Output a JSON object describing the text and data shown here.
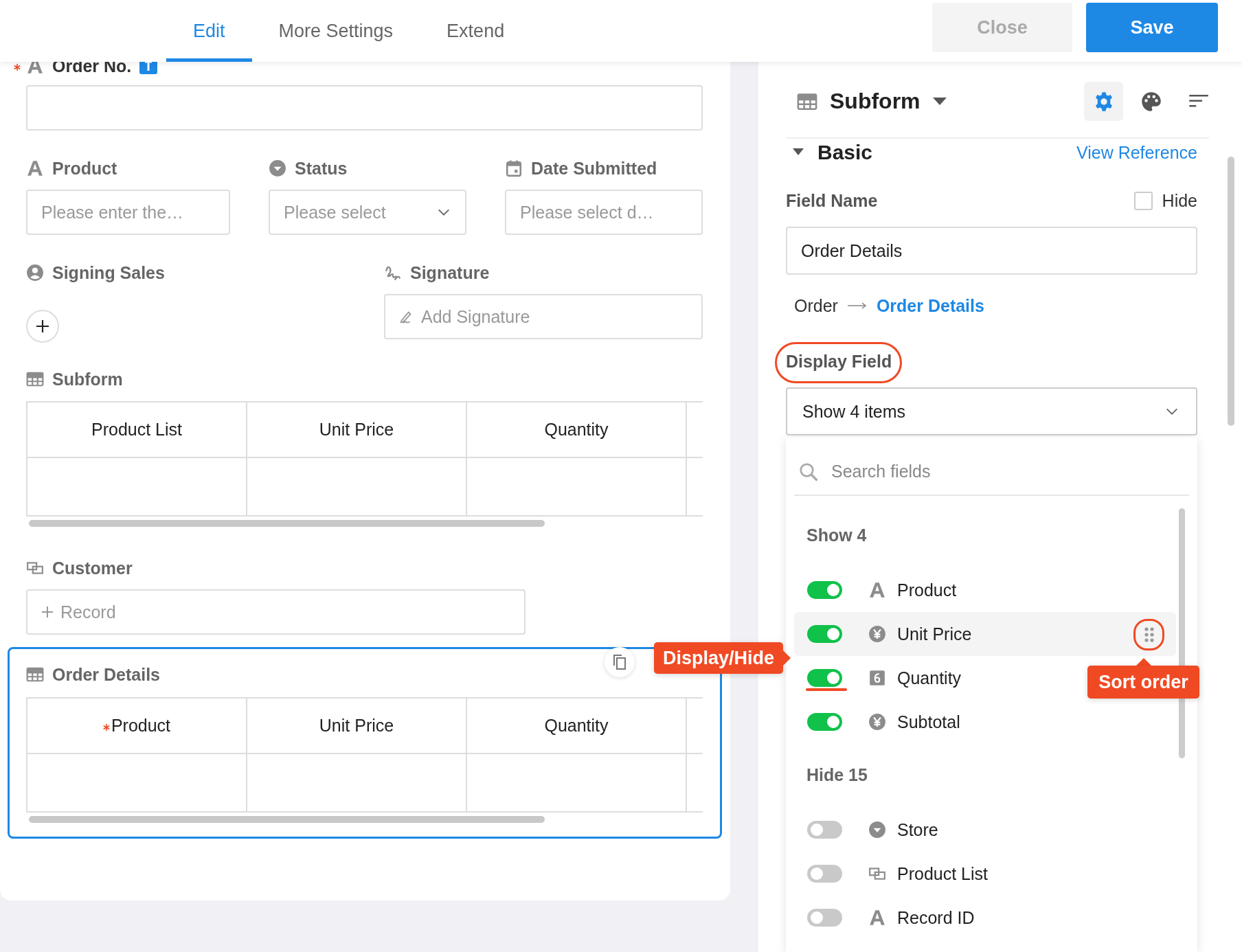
{
  "tabs": [
    {
      "label": "Edit",
      "selected": true
    },
    {
      "label": "More Settings",
      "selected": false
    },
    {
      "label": "Extend",
      "selected": false
    }
  ],
  "actions": [
    {
      "label": "Close",
      "kind": "secondary"
    },
    {
      "label": "Save",
      "kind": "primary"
    }
  ],
  "form": {
    "order_no": {
      "label": "Order No.",
      "required": true
    },
    "row_fields": [
      {
        "label": "Product",
        "kind": "text",
        "placeholder": "Please enter the…"
      },
      {
        "label": "Status",
        "kind": "select",
        "placeholder": "Please select"
      },
      {
        "label": "Date Submitted",
        "kind": "date",
        "placeholder": "Please select d…"
      }
    ],
    "signing_sales": {
      "label": "Signing Sales"
    },
    "signature": {
      "label": "Signature",
      "placeholder": "Add Signature"
    },
    "subform": {
      "label": "Subform",
      "columns": [
        {
          "label": "Product List",
          "required": false
        },
        {
          "label": "Unit Price",
          "required": false
        },
        {
          "label": "Quantity",
          "required": false
        }
      ]
    },
    "customer": {
      "label": "Customer",
      "placeholder": "Record"
    },
    "order_details": {
      "label": "Order Details",
      "selected": true,
      "columns": [
        {
          "label": "Product",
          "required": true
        },
        {
          "label": "Unit Price",
          "required": false
        },
        {
          "label": "Quantity",
          "required": false
        }
      ]
    }
  },
  "panel": {
    "title": "Subform",
    "tools": [
      {
        "kind": "settings",
        "selected": true
      },
      {
        "kind": "palette",
        "selected": false
      },
      {
        "kind": "sort",
        "selected": false
      }
    ],
    "section": {
      "title": "Basic",
      "expanded": true,
      "link": "View Reference"
    },
    "field_name": {
      "label": "Field Name",
      "value": "Order Details"
    },
    "hide": {
      "label": "Hide",
      "checked": false
    },
    "path": {
      "from": "Order",
      "to": "Order Details"
    },
    "display_field": {
      "label": "Display Field",
      "value": "Show 4 items",
      "circled": true
    },
    "dropdown": {
      "placeholder": "Search fields",
      "groups": [
        {
          "title": "Show 4",
          "items": [
            {
              "label": "Product",
              "kind": "text",
              "on": true,
              "hovered": false,
              "underlined": false
            },
            {
              "label": "Unit Price",
              "kind": "money",
              "on": true,
              "hovered": true,
              "underlined": false
            },
            {
              "label": "Quantity",
              "kind": "number",
              "on": true,
              "hovered": false,
              "underlined": true
            },
            {
              "label": "Subtotal",
              "kind": "money",
              "on": true,
              "hovered": false,
              "underlined": false
            }
          ]
        },
        {
          "title": "Hide 15",
          "items": [
            {
              "label": "Store",
              "kind": "select",
              "on": false,
              "hovered": false,
              "underlined": false
            },
            {
              "label": "Product List",
              "kind": "link",
              "on": false,
              "hovered": false,
              "underlined": false
            },
            {
              "label": "Record ID",
              "kind": "text",
              "on": false,
              "hovered": false,
              "underlined": false
            }
          ]
        }
      ]
    }
  },
  "annotations": {
    "display_hide": "Display/Hide",
    "sort_order": "Sort order"
  }
}
